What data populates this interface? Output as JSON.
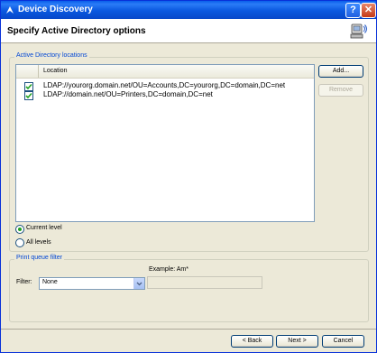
{
  "window": {
    "title": "Device Discovery",
    "help_label": "?",
    "close_label": "✕"
  },
  "header": {
    "title": "Specify Active Directory options"
  },
  "ad_group": {
    "legend": "Active Directory locations",
    "column_header": "Location",
    "rows": [
      {
        "checked": true,
        "location": "LDAP://yourorg.domain.net/OU=Accounts,DC=yourorg,DC=domain,DC=net"
      },
      {
        "checked": true,
        "location": "LDAP://domain.net/OU=Printers,DC=domain,DC=net"
      }
    ],
    "add_label": "Add...",
    "remove_label": "Remove"
  },
  "scope": {
    "current_level_label": "Current level",
    "all_levels_label": "All levels",
    "selected": "Current level"
  },
  "print_queue": {
    "legend": "Print queue filter",
    "example_label": "Example: Am*",
    "filter_label": "Filter:",
    "filter_value": "None",
    "filter_text": ""
  },
  "footer": {
    "back_label": "< Back",
    "next_label": "Next >",
    "cancel_label": "Cancel"
  },
  "colors": {
    "titlebar": "#0a58df",
    "legend_text": "#0046d5",
    "check": "#21a121"
  },
  "icons": [
    "app-icon",
    "network-device-icon",
    "checkmark-icon",
    "dropdown-arrow-icon"
  ]
}
